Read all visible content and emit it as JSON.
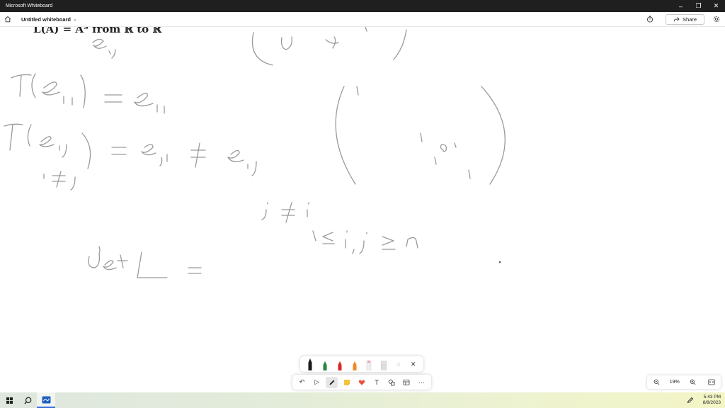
{
  "window": {
    "app_title": "Microsoft Whiteboard",
    "minimize_glyph": "–",
    "restore_glyph": "❐",
    "close_glyph": "✕"
  },
  "topbar": {
    "board_title": "Untitled whiteboard",
    "chevron": "⌄",
    "share_label": "Share"
  },
  "canvas": {
    "typed_equation": "L(A) = Aᵀ from ℝ     to ℝ"
  },
  "pen_tray": {
    "pens": [
      {
        "name": "black",
        "color": "#1a1a1a"
      },
      {
        "name": "green",
        "color": "#1f8a3b"
      },
      {
        "name": "red",
        "color": "#d62828"
      },
      {
        "name": "orange",
        "color": "#f08a24"
      },
      {
        "name": "highlighter-pink",
        "color": "#f5a0b5"
      },
      {
        "name": "eraser",
        "color": "#bdbdbd"
      }
    ],
    "lasso_glyph": "◌",
    "close_glyph": "✕"
  },
  "toolbar": {
    "undo_glyph": "↶",
    "select_glyph": "▷",
    "more_glyph": "···",
    "text_glyph": "T"
  },
  "zoom": {
    "level": "19%",
    "zoom_out_glyph": "−",
    "zoom_in_glyph": "+"
  },
  "taskbar": {
    "time": "5:43 PM",
    "date": "8/8/2023"
  },
  "colors": {
    "titlebar": "#1f1f1f",
    "ink": "#9a9a9a",
    "sticky_note": "#f7c43c",
    "reaction": "#e8543b"
  }
}
